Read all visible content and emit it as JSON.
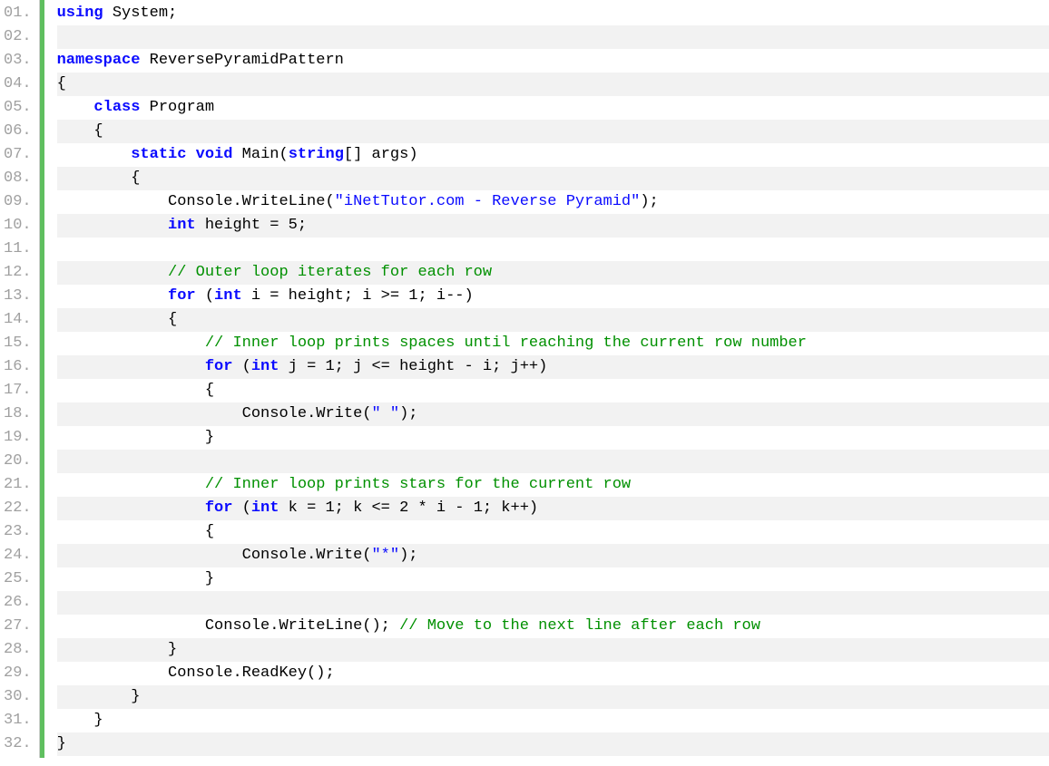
{
  "code": {
    "language": "csharp",
    "line_count": 32,
    "lines": [
      {
        "num": "01.",
        "indent": 0,
        "tokens": [
          {
            "t": "kw",
            "v": "using"
          },
          {
            "t": "txt",
            "v": " System;"
          }
        ]
      },
      {
        "num": "02.",
        "indent": 0,
        "tokens": []
      },
      {
        "num": "03.",
        "indent": 0,
        "tokens": [
          {
            "t": "kw",
            "v": "namespace"
          },
          {
            "t": "txt",
            "v": " ReversePyramidPattern"
          }
        ]
      },
      {
        "num": "04.",
        "indent": 0,
        "tokens": [
          {
            "t": "txt",
            "v": "{"
          }
        ]
      },
      {
        "num": "05.",
        "indent": 1,
        "tokens": [
          {
            "t": "kw",
            "v": "class"
          },
          {
            "t": "txt",
            "v": " Program"
          }
        ]
      },
      {
        "num": "06.",
        "indent": 1,
        "tokens": [
          {
            "t": "txt",
            "v": "{"
          }
        ]
      },
      {
        "num": "07.",
        "indent": 2,
        "tokens": [
          {
            "t": "kw",
            "v": "static"
          },
          {
            "t": "txt",
            "v": " "
          },
          {
            "t": "kw",
            "v": "void"
          },
          {
            "t": "txt",
            "v": " Main("
          },
          {
            "t": "kw",
            "v": "string"
          },
          {
            "t": "txt",
            "v": "[] args)"
          }
        ]
      },
      {
        "num": "08.",
        "indent": 2,
        "tokens": [
          {
            "t": "txt",
            "v": "{"
          }
        ]
      },
      {
        "num": "09.",
        "indent": 3,
        "tokens": [
          {
            "t": "txt",
            "v": "Console.WriteLine("
          },
          {
            "t": "str",
            "v": "\"iNetTutor.com - Reverse Pyramid\""
          },
          {
            "t": "txt",
            "v": ");"
          }
        ]
      },
      {
        "num": "10.",
        "indent": 3,
        "tokens": [
          {
            "t": "kw",
            "v": "int"
          },
          {
            "t": "txt",
            "v": " height = 5;"
          }
        ]
      },
      {
        "num": "11.",
        "indent": 0,
        "tokens": []
      },
      {
        "num": "12.",
        "indent": 3,
        "tokens": [
          {
            "t": "com",
            "v": "// Outer loop iterates for each row"
          }
        ]
      },
      {
        "num": "13.",
        "indent": 3,
        "tokens": [
          {
            "t": "kw",
            "v": "for"
          },
          {
            "t": "txt",
            "v": " ("
          },
          {
            "t": "kw",
            "v": "int"
          },
          {
            "t": "txt",
            "v": " i = height; i >= 1; i--)"
          }
        ]
      },
      {
        "num": "14.",
        "indent": 3,
        "tokens": [
          {
            "t": "txt",
            "v": "{"
          }
        ]
      },
      {
        "num": "15.",
        "indent": 4,
        "tokens": [
          {
            "t": "com",
            "v": "// Inner loop prints spaces until reaching the current row number"
          }
        ]
      },
      {
        "num": "16.",
        "indent": 4,
        "tokens": [
          {
            "t": "kw",
            "v": "for"
          },
          {
            "t": "txt",
            "v": " ("
          },
          {
            "t": "kw",
            "v": "int"
          },
          {
            "t": "txt",
            "v": " j = 1; j <= height - i; j++)"
          }
        ]
      },
      {
        "num": "17.",
        "indent": 4,
        "tokens": [
          {
            "t": "txt",
            "v": "{"
          }
        ]
      },
      {
        "num": "18.",
        "indent": 5,
        "tokens": [
          {
            "t": "txt",
            "v": "Console.Write("
          },
          {
            "t": "str",
            "v": "\" \""
          },
          {
            "t": "txt",
            "v": ");"
          }
        ]
      },
      {
        "num": "19.",
        "indent": 4,
        "tokens": [
          {
            "t": "txt",
            "v": "}"
          }
        ]
      },
      {
        "num": "20.",
        "indent": 0,
        "tokens": []
      },
      {
        "num": "21.",
        "indent": 4,
        "tokens": [
          {
            "t": "com",
            "v": "// Inner loop prints stars for the current row"
          }
        ]
      },
      {
        "num": "22.",
        "indent": 4,
        "tokens": [
          {
            "t": "kw",
            "v": "for"
          },
          {
            "t": "txt",
            "v": " ("
          },
          {
            "t": "kw",
            "v": "int"
          },
          {
            "t": "txt",
            "v": " k = 1; k <= 2 * i - 1; k++)"
          }
        ]
      },
      {
        "num": "23.",
        "indent": 4,
        "tokens": [
          {
            "t": "txt",
            "v": "{"
          }
        ]
      },
      {
        "num": "24.",
        "indent": 5,
        "tokens": [
          {
            "t": "txt",
            "v": "Console.Write("
          },
          {
            "t": "str",
            "v": "\"*\""
          },
          {
            "t": "txt",
            "v": ");"
          }
        ]
      },
      {
        "num": "25.",
        "indent": 4,
        "tokens": [
          {
            "t": "txt",
            "v": "}"
          }
        ]
      },
      {
        "num": "26.",
        "indent": 0,
        "tokens": []
      },
      {
        "num": "27.",
        "indent": 4,
        "tokens": [
          {
            "t": "txt",
            "v": "Console.WriteLine(); "
          },
          {
            "t": "com",
            "v": "// Move to the next line after each row"
          }
        ]
      },
      {
        "num": "28.",
        "indent": 3,
        "tokens": [
          {
            "t": "txt",
            "v": "}"
          }
        ]
      },
      {
        "num": "29.",
        "indent": 3,
        "tokens": [
          {
            "t": "txt",
            "v": "Console.ReadKey();"
          }
        ]
      },
      {
        "num": "30.",
        "indent": 2,
        "tokens": [
          {
            "t": "txt",
            "v": "}"
          }
        ]
      },
      {
        "num": "31.",
        "indent": 1,
        "tokens": [
          {
            "t": "txt",
            "v": "}"
          }
        ]
      },
      {
        "num": "32.",
        "indent": 0,
        "tokens": [
          {
            "t": "txt",
            "v": "}"
          }
        ]
      }
    ]
  },
  "style": {
    "indent_unit": "    ",
    "stripe_even_bg": "#f2f2f2",
    "stripe_odd_bg": "#ffffff",
    "marker_color": "#5fbf5f"
  }
}
